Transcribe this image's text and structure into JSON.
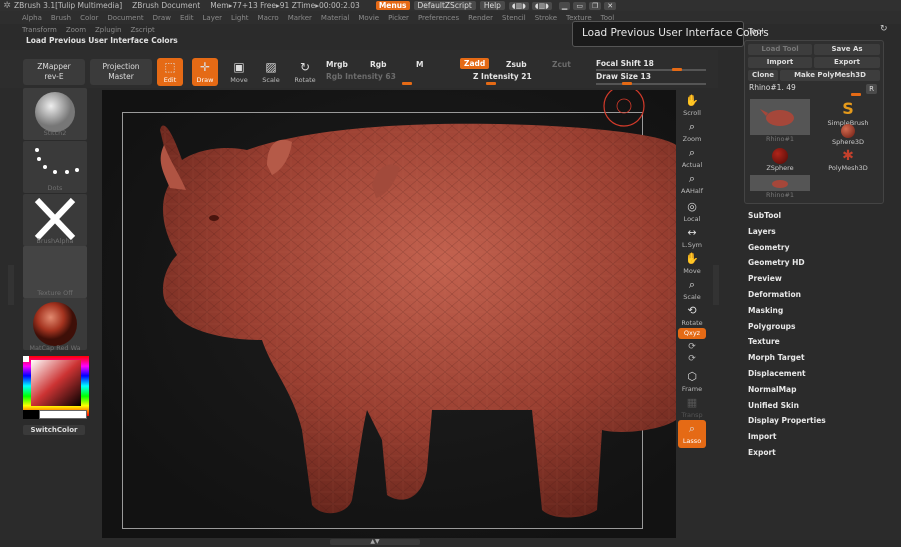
{
  "title_bar": {
    "app": "ZBrush 3.1[Tulip Multimedia]",
    "document": "ZBrush Document",
    "stats": "Mem▸77+13 Free▸91 ZTime▸00:00:2.03",
    "menus_label": "Menus",
    "script_label": "DefaultZScript",
    "help_label": "Help"
  },
  "menu_row1": [
    "Alpha",
    "Brush",
    "Color",
    "Document",
    "Draw",
    "Edit",
    "Layer",
    "Light",
    "Macro",
    "Marker",
    "Material",
    "Movie",
    "Picker",
    "Preferences",
    "Render",
    "Stencil",
    "Stroke",
    "Texture",
    "Tool"
  ],
  "menu_row2": [
    "Transform",
    "Zoom",
    "Zplugin",
    "Zscript"
  ],
  "info_line": "Load Previous User Interface Colors",
  "toolbar": {
    "zmapper": "ZMapper",
    "zmapper_sub": "rev-E",
    "projection": "Projection",
    "projection_sub": "Master",
    "edit": "Edit",
    "draw": "Draw",
    "move": "Move",
    "scale": "Scale",
    "rotate": "Rotate",
    "mrgb": "Mrgb",
    "rgb": "Rgb",
    "m": "M",
    "rgb_intensity": "Rgb Intensity 63",
    "zadd": "Zadd",
    "zsub": "Zsub",
    "zcut": "Zcut",
    "z_intensity": "Z Intensity 21",
    "focal_shift": "Focal Shift 18",
    "draw_size": "Draw Size 13"
  },
  "left_shelf": {
    "brush_label": "Stitch2",
    "stroke_label": "Dots",
    "alpha_label": "BrushAlpha",
    "texture_label": "Texture Off",
    "material_label": "MatCap Red Wa",
    "switch_color": "SwitchColor"
  },
  "right_shelf": [
    "Scroll",
    "Zoom",
    "Actual",
    "AAHalf",
    "Local",
    "L.Sym",
    "Move",
    "Scale",
    "Rotate",
    "Qxyz",
    "Frame",
    "Transp",
    "Lasso"
  ],
  "tool_palette": {
    "title": "Tool",
    "tooltip": "Load Previous User Interface Colors",
    "load_tool": "Load Tool",
    "save_as": "Save As",
    "import": "Import",
    "export": "Export",
    "clone": "Clone",
    "make_polymesh": "Make PolyMesh3D",
    "current_tool": "Rhino#1. 49",
    "r_button": "R",
    "items": [
      "Rhino#1",
      "SimpleBrush",
      "Sphere3D",
      "ZSphere",
      "PolyMesh3D",
      "Rhino#1"
    ]
  },
  "tool_menu": [
    "SubTool",
    "Layers",
    "Geometry",
    "Geometry HD",
    "Preview",
    "Deformation",
    "Masking",
    "Polygroups",
    "Texture",
    "Morph Target",
    "Displacement",
    "NormalMap",
    "Unified Skin",
    "Display Properties",
    "Import",
    "Export"
  ],
  "colors": {
    "accent": "#e56a15",
    "background": "#2b2b2b",
    "model": "#a5473a"
  }
}
